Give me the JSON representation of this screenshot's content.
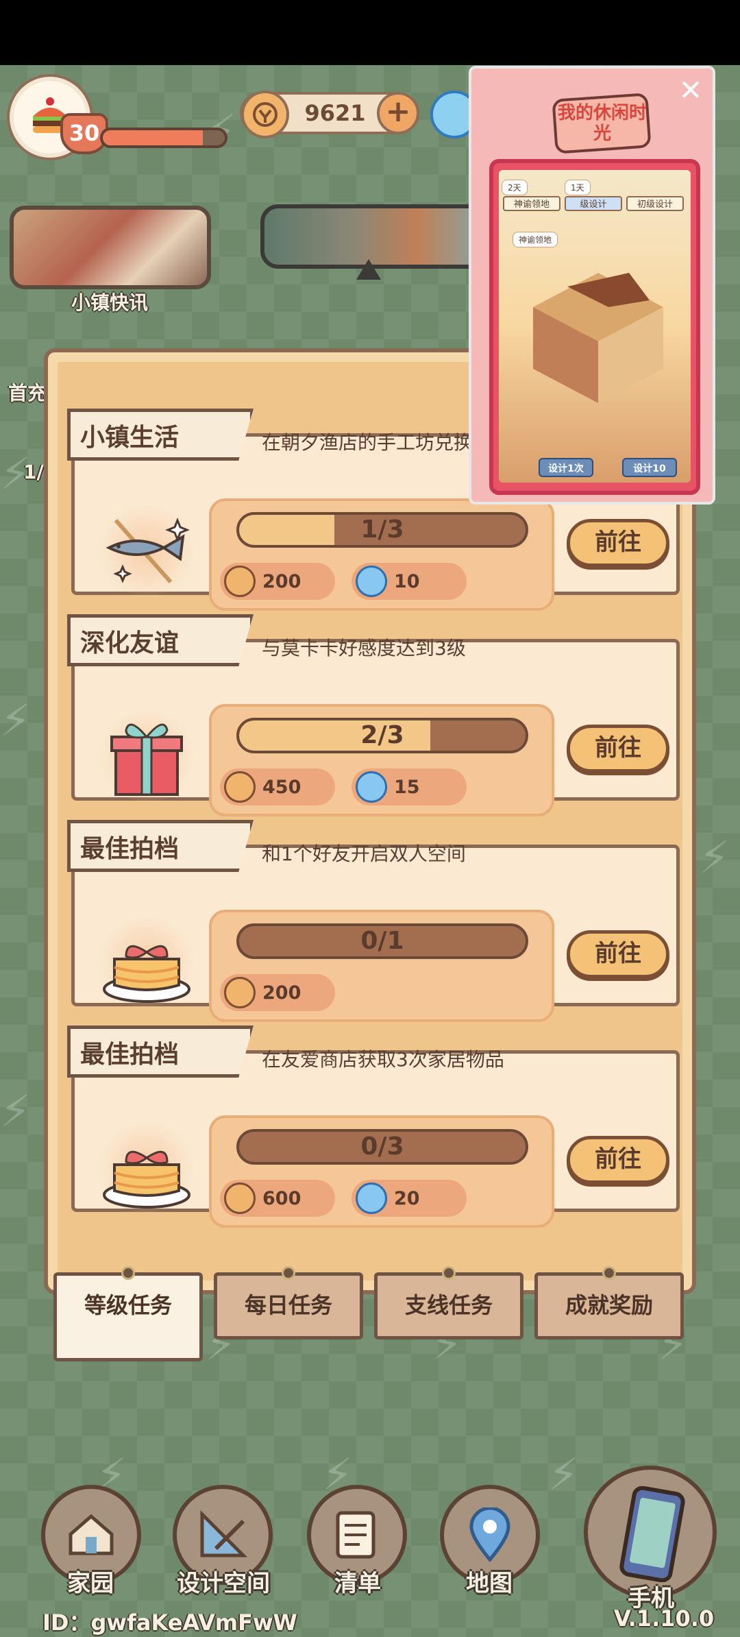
{
  "hud": {
    "level": "30",
    "xp_fraction": 0.82,
    "coins": "9621"
  },
  "news": {
    "label": "小镇快讯"
  },
  "side": {
    "first_charge": "首充",
    "small_text": "1/"
  },
  "quests": [
    {
      "title": "小镇生活",
      "desc": "在朝夕渔店的手工坊兑换",
      "progress_text": "1/3",
      "progress": 0.333,
      "rewards": [
        {
          "type": "coin",
          "value": "200"
        },
        {
          "type": "gem",
          "value": "10"
        }
      ],
      "button": "前往",
      "icon": "fish-icon"
    },
    {
      "title": "深化友谊",
      "desc": "与莫卡卡好感度达到3级",
      "progress_text": "2/3",
      "progress": 0.667,
      "rewards": [
        {
          "type": "coin",
          "value": "450"
        },
        {
          "type": "gem",
          "value": "15"
        }
      ],
      "button": "前往",
      "icon": "gift-icon"
    },
    {
      "title": "最佳拍档",
      "desc": "和1个好友开启双人空间",
      "progress_text": "0/1",
      "progress": 0,
      "rewards": [
        {
          "type": "coin",
          "value": "200"
        }
      ],
      "button": "前往",
      "icon": "cake-icon"
    },
    {
      "title": "最佳拍档",
      "desc": "在友爱商店获取3次家居物品",
      "progress_text": "0/3",
      "progress": 0,
      "rewards": [
        {
          "type": "coin",
          "value": "600"
        },
        {
          "type": "gem",
          "value": "20"
        }
      ],
      "button": "前往",
      "icon": "cake-icon"
    }
  ],
  "tabs": [
    "等级任务",
    "每日任务",
    "支线任务",
    "成就奖励"
  ],
  "popup": {
    "title": "我的休闲时光",
    "tab_labels": [
      "神谕领地",
      "级设计",
      "初级设计"
    ],
    "chip_label": "神谕领地",
    "buttons": [
      "设计1次",
      "设计10"
    ],
    "days": [
      "2天",
      "1天"
    ]
  },
  "nav": [
    "家园",
    "设计空间",
    "清单",
    "地图",
    "手机"
  ],
  "footer": {
    "id": "ID：gwfaKeAVmFwW",
    "version": "V.1.10.0"
  },
  "colors": {
    "board": "#f0c58c",
    "card": "#fbe9d2",
    "button": "#f4c276",
    "scene": "#6e8a6b"
  }
}
